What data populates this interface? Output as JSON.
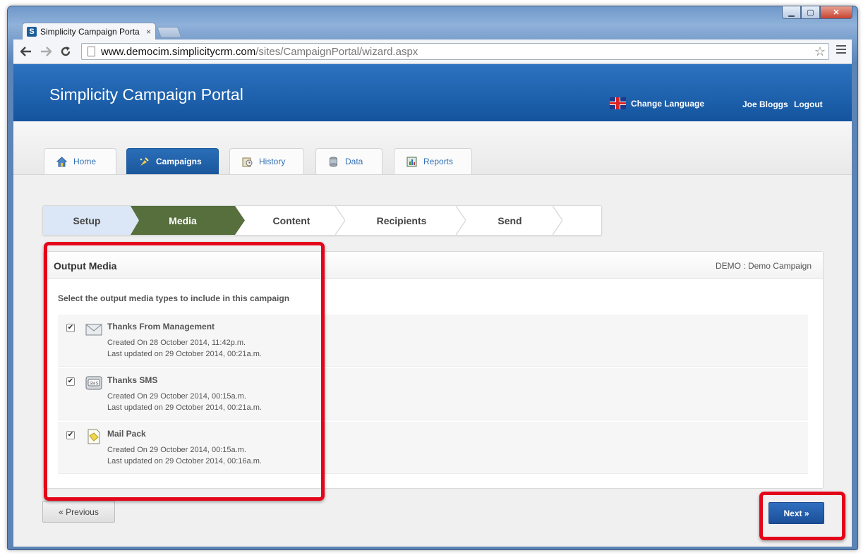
{
  "browser": {
    "tab_title": "Simplicity Campaign Porta",
    "tab_close": "×",
    "favicon_letter": "S",
    "url_host": "www.democim.simplicitycrm.com",
    "url_path": "/sites/CampaignPortal/wizard.aspx",
    "back_icon": "back-arrow-icon",
    "forward_icon": "forward-arrow-icon",
    "reload_icon": "reload-icon",
    "star_icon": "bookmark-star-icon",
    "window_min": "▁",
    "window_max": "▢",
    "window_close": "✕"
  },
  "header": {
    "title": "Simplicity Campaign Portal",
    "change_language": "Change Language",
    "user": "Joe Bloggs",
    "logout": "Logout"
  },
  "nav_tabs": [
    {
      "label": "Home",
      "icon": "home-icon",
      "active": false
    },
    {
      "label": "Campaigns",
      "icon": "campaigns-icon",
      "active": true
    },
    {
      "label": "History",
      "icon": "history-icon",
      "active": false
    },
    {
      "label": "Data",
      "icon": "database-icon",
      "active": false
    },
    {
      "label": "Reports",
      "icon": "reports-icon",
      "active": false
    }
  ],
  "wizard": {
    "steps": [
      {
        "label": "Setup",
        "state": "done"
      },
      {
        "label": "Media",
        "state": "current"
      },
      {
        "label": "Content",
        "state": "pending"
      },
      {
        "label": "Recipients",
        "state": "pending"
      },
      {
        "label": "Send",
        "state": "pending"
      }
    ]
  },
  "panel": {
    "title": "Output Media",
    "campaign": "DEMO : Demo Campaign",
    "instruction": "Select the output media types to include in this campaign",
    "items": [
      {
        "name": "Thanks From Management",
        "icon": "email-icon",
        "checked": true,
        "created": "Created On 28 October 2014, 11:42p.m.",
        "updated": "Last updated on 29 October 2014, 00:21a.m."
      },
      {
        "name": "Thanks SMS",
        "icon": "sms-icon",
        "checked": true,
        "created": "Created On 29 October 2014, 00:15a.m.",
        "updated": "Last updated on 29 October 2014, 00:21a.m."
      },
      {
        "name": "Mail Pack",
        "icon": "mail-pack-icon",
        "checked": true,
        "created": "Created On 29 October 2014, 00:15a.m.",
        "updated": "Last updated on 29 October 2014, 00:16a.m."
      }
    ]
  },
  "buttons": {
    "previous": "« Previous",
    "next": "Next »"
  },
  "colors": {
    "banner": "#1d62ad",
    "current_step": "#566f3d",
    "highlight": "#e3061a"
  }
}
